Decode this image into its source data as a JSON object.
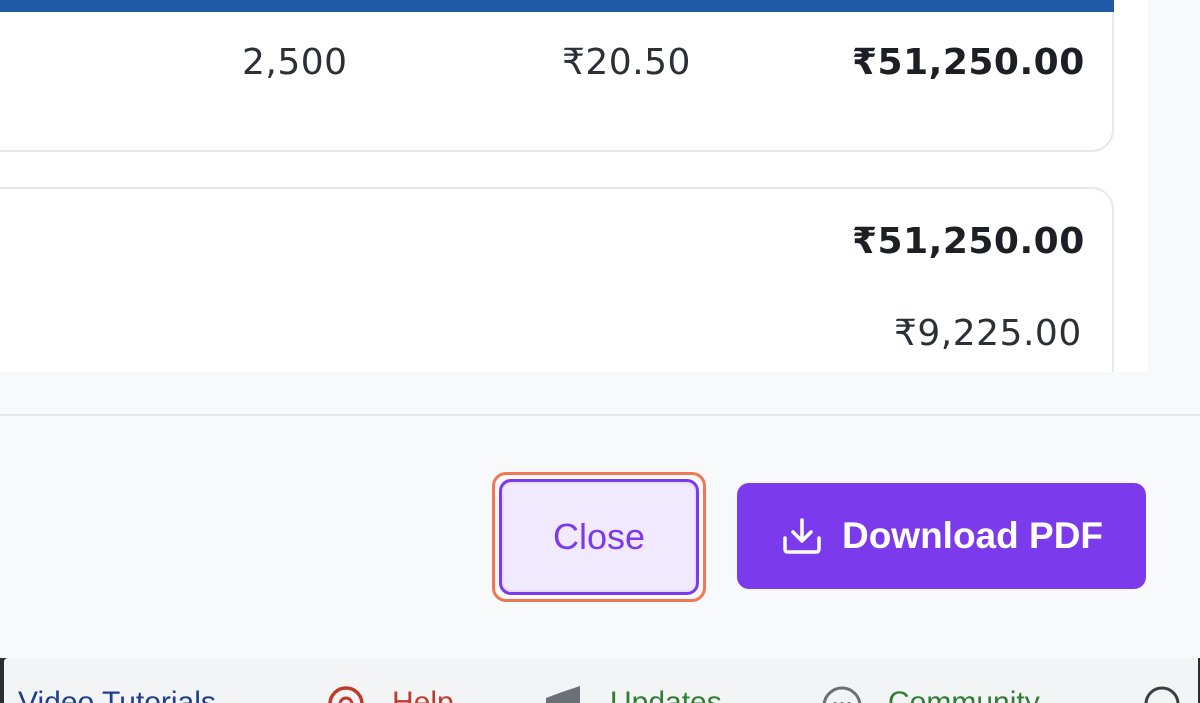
{
  "line_item": {
    "quantity": "2,500",
    "rate": "₹20.50",
    "amount": "₹51,250.00"
  },
  "summary": {
    "subtotal": "₹51,250.00",
    "tax": "₹9,225.00"
  },
  "footer": {
    "close_label": "Close",
    "download_label": "Download PDF"
  },
  "bottom_bar": {
    "items": [
      {
        "label": "Video Tutorials",
        "color": "#1f3f8a"
      },
      {
        "label": "Help",
        "color": "#c0392b"
      },
      {
        "label": "Updates",
        "color": "#2e7d32"
      },
      {
        "label": "Community",
        "color": "#2e7d32"
      }
    ]
  },
  "colors": {
    "accent": "#7c3aed",
    "highlight": "#f07857",
    "table_header": "#1f5aa6"
  }
}
